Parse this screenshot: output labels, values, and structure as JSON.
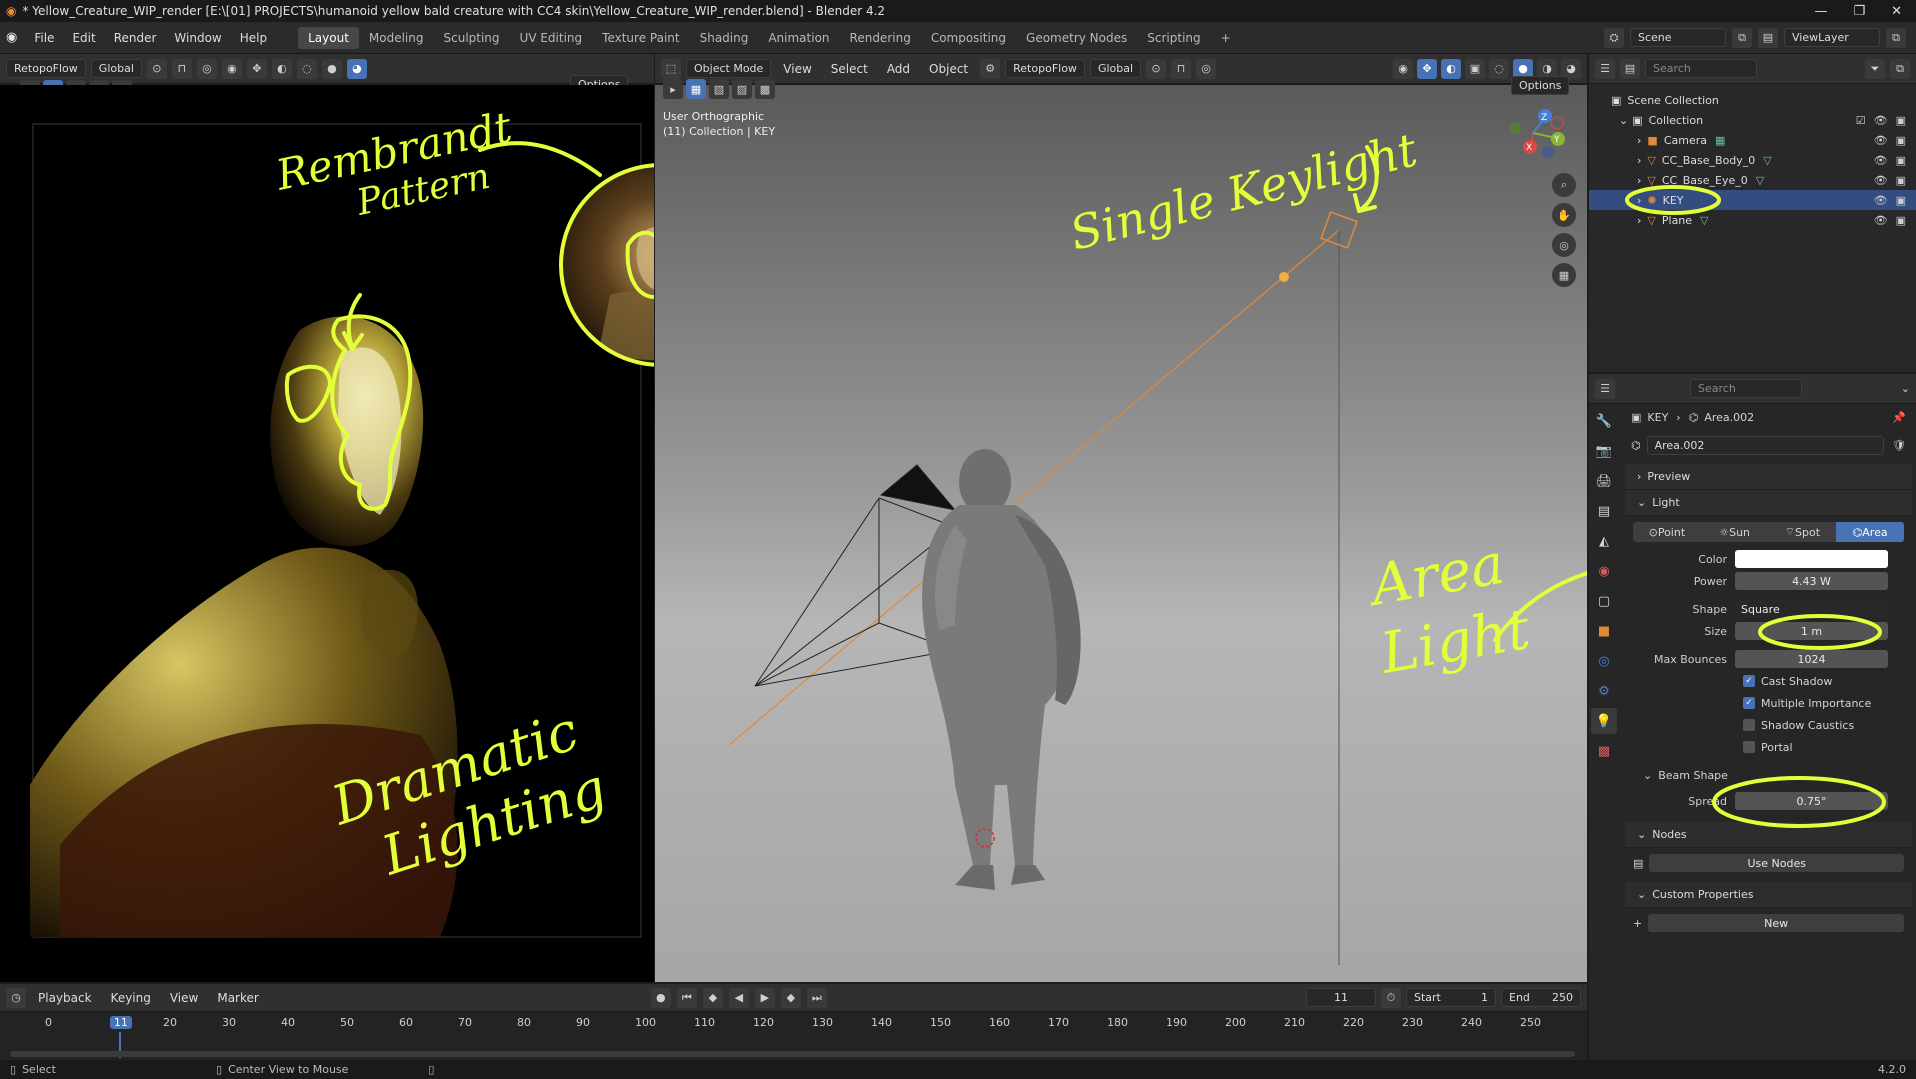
{
  "titlebar": {
    "title": "* Yellow_Creature_WIP_render [E:\\[01] PROJECTS\\humanoid yellow bald creature with CC4 skin\\Yellow_Creature_WIP_render.blend] - Blender 4.2",
    "app_icon": "blender-logo-icon"
  },
  "menus": [
    "File",
    "Edit",
    "Render",
    "Window",
    "Help"
  ],
  "workspaces": [
    "Layout",
    "Modeling",
    "Sculpting",
    "UV Editing",
    "Texture Paint",
    "Shading",
    "Animation",
    "Rendering",
    "Compositing",
    "Geometry Nodes",
    "Scripting"
  ],
  "active_workspace": "Layout",
  "scene": {
    "label": "Scene",
    "viewlayer": "ViewLayer"
  },
  "image_editor": {
    "retopo": "RetopoFlow",
    "orientation": "Global",
    "options": "Options"
  },
  "viewport": {
    "mode": "Object Mode",
    "menus": [
      "View",
      "Select",
      "Add",
      "Object"
    ],
    "retopo": "RetopoFlow",
    "orientation": "Global",
    "options": "Options",
    "overlay_line1": "User Orthographic",
    "overlay_line2": "(11) Collection | KEY",
    "gizmo_axes": [
      "X",
      "Y",
      "Z"
    ]
  },
  "outliner": {
    "search_placeholder": "Search",
    "root": "Scene Collection",
    "collection": "Collection",
    "items": [
      "Camera",
      "CC_Base_Body_0",
      "CC_Base_Eye_0",
      "KEY",
      "Plane"
    ],
    "selected": "KEY"
  },
  "properties": {
    "search_placeholder": "Search",
    "breadcrumb_object": "KEY",
    "breadcrumb_data": "Area.002",
    "datablock": "Area.002",
    "panels": {
      "preview": "Preview",
      "light": "Light",
      "beam_shape": "Beam Shape",
      "nodes": "Nodes",
      "custom_properties": "Custom Properties"
    },
    "light_types": [
      "Point",
      "Sun",
      "Spot",
      "Area"
    ],
    "active_light_type": "Area",
    "color_label": "Color",
    "color_value": "#ffffff",
    "power_label": "Power",
    "power_value": "4.43 W",
    "shape_label": "Shape",
    "shape_value": "Square",
    "size_label": "Size",
    "size_value": "1 m",
    "bounces_label": "Max Bounces",
    "bounces_value": "1024",
    "cast_shadow": "Cast Shadow",
    "multiple_importance": "Multiple Importance",
    "shadow_caustics": "Shadow Caustics",
    "portal": "Portal",
    "spread_label": "Spread",
    "spread_value": "0.75°",
    "use_nodes": "Use Nodes",
    "new_label": "New"
  },
  "timeline": {
    "menus": [
      "Playback",
      "Keying",
      "View",
      "Marker"
    ],
    "current_frame": "11",
    "start_label": "Start",
    "start_value": "1",
    "end_label": "End",
    "end_value": "250",
    "ruler": [
      "0",
      "11",
      "20",
      "30",
      "40",
      "50",
      "60",
      "70",
      "80",
      "90",
      "100",
      "110",
      "120",
      "130",
      "140",
      "150",
      "160",
      "170",
      "180",
      "190",
      "200",
      "210",
      "220",
      "230",
      "240",
      "250"
    ]
  },
  "statusbar": {
    "select": "Select",
    "center": "Center View to Mouse",
    "version": "4.2.0"
  },
  "annotations": {
    "rembrandt": [
      "Rembrandt",
      "Pattern"
    ],
    "single_keylight": "Single Keylight",
    "dramatic": [
      "Dramatic",
      "Lighting"
    ],
    "area_light": [
      "Area",
      "Light"
    ],
    "color": "#e4ff3a"
  }
}
